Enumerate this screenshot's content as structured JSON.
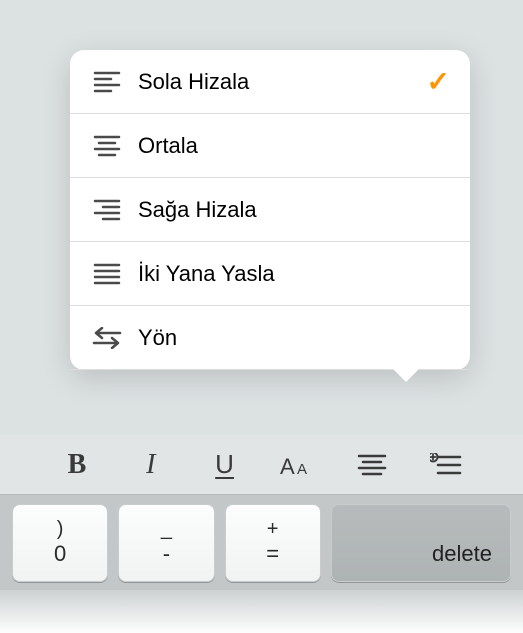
{
  "popover": {
    "items": [
      {
        "label": "Sola Hizala",
        "icon": "align-left-icon",
        "selected": true
      },
      {
        "label": "Ortala",
        "icon": "align-center-icon",
        "selected": false
      },
      {
        "label": "Sağa Hizala",
        "icon": "align-right-icon",
        "selected": false
      },
      {
        "label": "İki Yana Yasla",
        "icon": "align-justify-icon",
        "selected": false
      },
      {
        "label": "Yön",
        "icon": "direction-icon",
        "selected": false
      }
    ],
    "checkmark": "✓"
  },
  "toolbar": {
    "bold": "B",
    "italic": "I",
    "underline": "U"
  },
  "keys": {
    "k0": {
      "upper": ")",
      "lower": "0"
    },
    "k1": {
      "upper": "_",
      "lower": "-"
    },
    "k2": {
      "upper": "+",
      "lower": "="
    },
    "delete": "delete"
  }
}
